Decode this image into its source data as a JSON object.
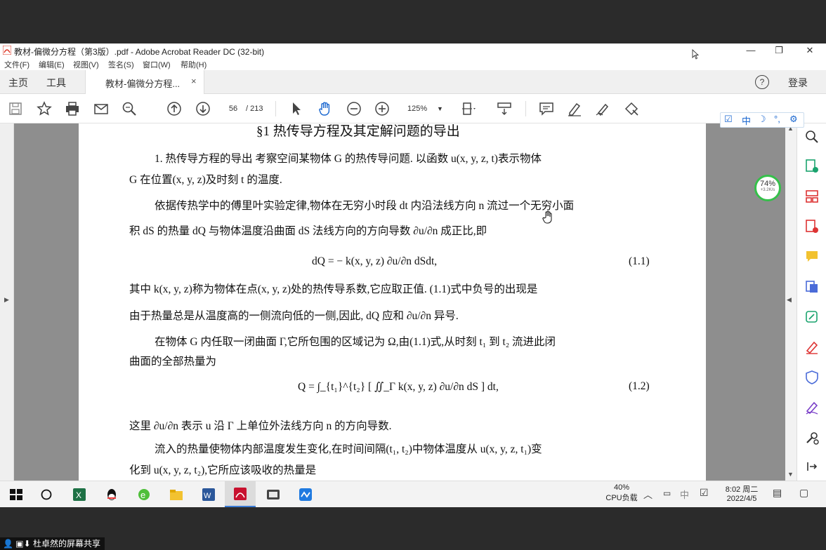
{
  "window": {
    "title": "教材-偏微分方程（第3版）.pdf - Adobe Acrobat Reader DC (32-bit)",
    "controls": {
      "minimize": "—",
      "restore": "❐",
      "close": "✕"
    }
  },
  "menu": [
    "文件(F)",
    "编辑(E)",
    "视图(V)",
    "签名(S)",
    "窗口(W)",
    "帮助(H)"
  ],
  "tabs": {
    "home": "主页",
    "tools": "工具",
    "doc_tab": "教材-偏微分方程...",
    "close": "×",
    "help": "?",
    "login": "登录"
  },
  "toolbar": {
    "page_current": "56",
    "page_total": "/ 213",
    "zoom": "125%"
  },
  "document": {
    "heading": "§1   热传导方程及其定解问题的导出",
    "lines": [
      "1. 热传导方程的导出    考察空间某物体 G 的热传导问题. 以函数 u(x, y, z, t)表示物体",
      "G 在位置(x, y, z)及时刻 t 的温度.",
      "依据传热学中的傅里叶实验定律,物体在无穷小时段 dt 内沿法线方向 n 流过一个无穷小面",
      "积 dS 的热量 dQ 与物体温度沿曲面 dS 法线方向的方向导数 ∂u/∂n 成正比,即",
      "dQ = − k(x, y, z) ∂u/∂n dSdt,",
      "其中 k(x, y, z)称为物体在点(x, y, z)处的热传导系数,它应取正值. (1.1)式中负号的出现是",
      "由于热量总是从温度高的一侧流向低的一侧,因此, dQ 应和 ∂u/∂n 异号.",
      "在物体 G 内任取一闭曲面 Γ,它所包围的区域记为 Ω,由(1.1)式,从时刻 t₁ 到 t₂ 流进此闭",
      "曲面的全部热量为",
      "Q = ∫_{t₁}^{t₂} [ ∬_Γ k(x, y, z) ∂u/∂n dS ] dt,",
      "这里 ∂u/∂n 表示 u 沿 Γ 上单位外法线方向 n 的方向导数.",
      "流入的热量使物体内部温度发生变化,在时间间隔(t₁, t₂)中物体温度从 u(x, y, z, t₁)变",
      "化到 u(x, y, z, t₂),它所应该吸收的热量是"
    ],
    "eq1_no": "(1.1)",
    "eq2_no": "(1.2)"
  },
  "ime": {
    "mode": "中"
  },
  "speed_widget": {
    "percent": "74%",
    "rate": "+3.2K/s"
  },
  "taskbar": {
    "cpu_percent": "40%",
    "cpu_label": "CPU负载",
    "ime": "中",
    "time": "8:02 周二",
    "date": "2022/4/5"
  },
  "screen_share": {
    "label": "杜卓然的屏幕共享"
  }
}
